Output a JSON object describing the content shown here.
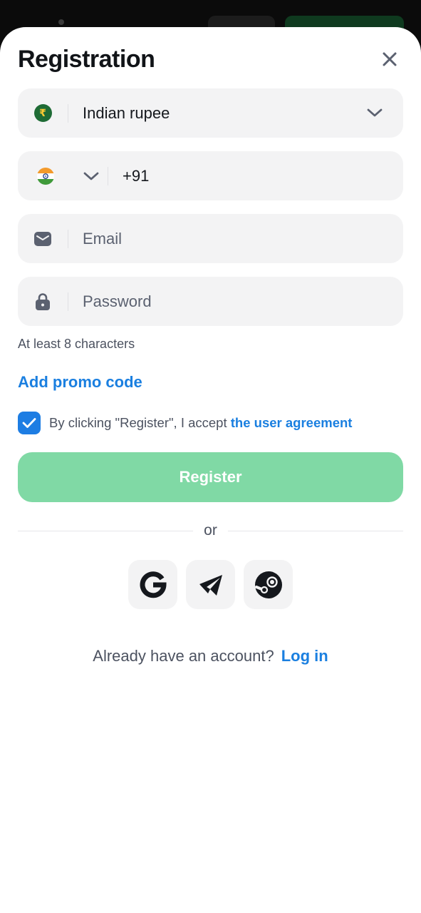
{
  "title": "Registration",
  "currency": {
    "label": "Indian rupee",
    "symbol": "₹"
  },
  "phone": {
    "value": "+91"
  },
  "email": {
    "placeholder": "Email"
  },
  "password": {
    "placeholder": "Password",
    "hint": "At least 8 characters"
  },
  "promo": {
    "label": "Add promo code"
  },
  "agreement": {
    "text": "By clicking \"Register\", I accept ",
    "link": "the user agreement",
    "checked": true
  },
  "register": {
    "label": "Register"
  },
  "divider": {
    "label": "or"
  },
  "socials": {
    "icons": [
      "google-icon",
      "telegram-icon",
      "steam-icon"
    ]
  },
  "login": {
    "prompt": "Already have an account?",
    "link": "Log in"
  },
  "colors": {
    "accent": "#1a7fe0",
    "register_bg": "#80d9a5",
    "field_bg": "#f3f3f4"
  }
}
